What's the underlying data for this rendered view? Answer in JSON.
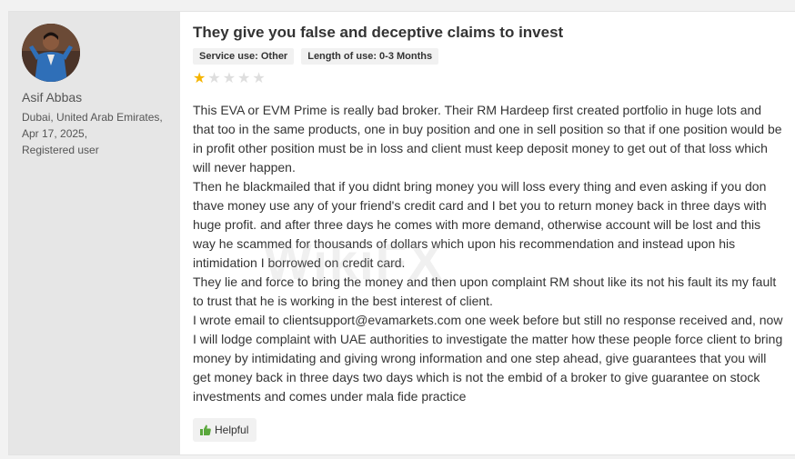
{
  "user": {
    "name": "Asif Abbas",
    "location": "Dubai, United Arab Emirates,",
    "date": "Apr 17, 2025,",
    "status": "Registered user"
  },
  "review": {
    "title": "They give you false and deceptive claims to invest",
    "tags": [
      "Service use: Other",
      "Length of use: 0-3 Months"
    ],
    "rating": 1,
    "rating_max": 5,
    "paragraphs": [
      "This EVA or EVM Prime is really bad broker. Their RM Hardeep first created portfolio in huge lots and that too in the same products, one in buy position and one in sell position so that if one position would be in profit other position must be in loss and client must keep deposit money to get out of that loss which will never happen.",
      "Then he blackmailed that if you didnt bring money you will loss every thing and even asking if you don thave money use any of your friend's credit card and I bet you to return money back in three days with huge profit. and after three days he comes with more demand, otherwise account will be lost and this way he scammed for thousands of dollars which upon his recommendation and instead upon his intimidation I borrowed on credit card.",
      "They lie and force to bring the money and then upon complaint RM shout like its not his fault its my fault to trust that he is working in the best interest of client.",
      "I wrote email to clientsupport@evamarkets.com one week before but still no response received and, now I will lodge complaint with UAE authorities to investigate the matter how these people force client to bring money by intimidating and giving wrong information and one step ahead, give guarantees that you will get money back in three days two days which is not the embid of a broker to give guarantee on stock investments and comes under mala fide practice"
    ]
  },
  "actions": {
    "helpful_label": "Helpful"
  },
  "watermark": "WikiFX",
  "colors": {
    "star_filled": "#f5b400",
    "star_empty": "#dedede",
    "thumb": "#5aa83c",
    "sidebar_bg": "#e6e6e6"
  },
  "icons": {
    "star": "star-icon",
    "thumb": "thumbs-up-icon"
  }
}
